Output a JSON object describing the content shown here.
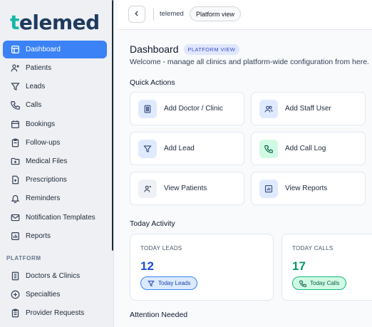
{
  "brand": {
    "name_accent": "t",
    "name_rest": "elemed"
  },
  "sidebar": {
    "items": [
      {
        "label": "Dashboard",
        "icon": "dashboard-icon",
        "active": true
      },
      {
        "label": "Patients",
        "icon": "patients-icon"
      },
      {
        "label": "Leads",
        "icon": "funnel-icon"
      },
      {
        "label": "Calls",
        "icon": "phone-icon"
      },
      {
        "label": "Bookings",
        "icon": "calendar-icon"
      },
      {
        "label": "Follow-ups",
        "icon": "clipboard-icon"
      },
      {
        "label": "Medical Files",
        "icon": "folder-icon"
      },
      {
        "label": "Prescriptions",
        "icon": "prescription-icon"
      },
      {
        "label": "Reminders",
        "icon": "bell-icon"
      },
      {
        "label": "Notification Templates",
        "icon": "mail-icon"
      },
      {
        "label": "Reports",
        "icon": "chart-icon"
      }
    ],
    "platform_section": "PLATFORM",
    "platform_items": [
      {
        "label": "Doctors & Clinics",
        "icon": "building-icon"
      },
      {
        "label": "Specialties",
        "icon": "plus-circle-icon"
      },
      {
        "label": "Provider Requests",
        "icon": "clipboard-list-icon"
      }
    ]
  },
  "header": {
    "breadcrumb": "telemed",
    "view_pill": "Platform view"
  },
  "main": {
    "title": "Dashboard",
    "title_badge": "PLATFORM VIEW",
    "subtitle": "Welcome - manage all clinics and platform-wide configuration from here.",
    "quick_actions_title": "Quick Actions",
    "quick_actions": [
      {
        "label": "Add Doctor / Clinic",
        "icon": "building-icon",
        "tone": "blue"
      },
      {
        "label": "Add Staff User",
        "icon": "users-icon",
        "tone": "blue"
      },
      {
        "label": "Add Lead",
        "icon": "funnel-icon",
        "tone": "blue"
      },
      {
        "label": "Add Call Log",
        "icon": "phone-icon",
        "tone": "green"
      },
      {
        "label": "View Patients",
        "icon": "patient-icon",
        "tone": "gray"
      },
      {
        "label": "View Reports",
        "icon": "chart-icon",
        "tone": "blue"
      }
    ],
    "today_activity_title": "Today Activity",
    "stats": [
      {
        "label": "TODAY LEADS",
        "value": "12",
        "pill": "Today Leads",
        "color": "#1d4ed8"
      },
      {
        "label": "TODAY CALLS",
        "value": "17",
        "pill": "Today Calls",
        "color": "#059669"
      }
    ],
    "attention_title": "Attention Needed"
  },
  "colors": {
    "accent": "#3b82f6",
    "brand_teal": "#14b8a6",
    "brand_navy": "#1e3a5f"
  }
}
